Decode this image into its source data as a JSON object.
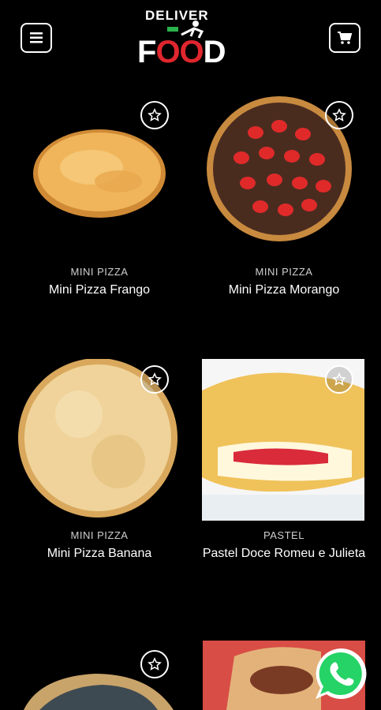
{
  "header": {
    "logo_top": "DELIVER",
    "logo_bottom_a": "F",
    "logo_bottom_b": "OO",
    "logo_bottom_c": "D",
    "menu_icon": "hamburger-menu-icon",
    "cart_icon": "shopping-cart-icon"
  },
  "products": [
    {
      "category": "MINI PIZZA",
      "name": "Mini Pizza Frango"
    },
    {
      "category": "MINI PIZZA",
      "name": "Mini Pizza Morango"
    },
    {
      "category": "MINI PIZZA",
      "name": "Mini Pizza Banana"
    },
    {
      "category": "PASTEL",
      "name": "Pastel Doce Romeu e Julieta"
    }
  ],
  "colors": {
    "background": "#000000",
    "accent_red": "#e0262e",
    "accent_green": "#2bb24c",
    "whatsapp_green": "#25d366"
  }
}
